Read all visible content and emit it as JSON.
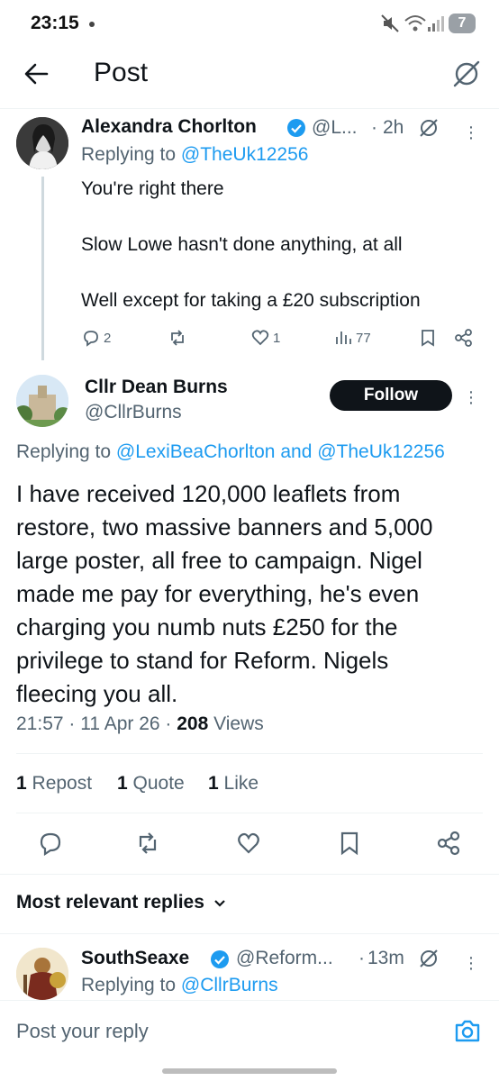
{
  "status_bar": {
    "time": "23:15",
    "battery": "7"
  },
  "header": {
    "title": "Post"
  },
  "parent_tweet": {
    "name": "Alexandra Chorlton",
    "handle": "@L...",
    "time": "2h",
    "replying_prefix": "Replying to",
    "replying_to": "@TheUk12256",
    "lines": [
      "You're right there",
      "Slow Lowe hasn't done anything, at all",
      "Well except for taking a £20 subscription"
    ],
    "actions": {
      "replies": "2",
      "likes": "1",
      "views": "77"
    }
  },
  "main_tweet": {
    "name": "Cllr Dean Burns",
    "handle": "@CllrBurns",
    "follow_label": "Follow",
    "replying_prefix": "Replying to",
    "replying_to_1": "@LexiBeaChorlton",
    "replying_and": "and",
    "replying_to_2": "@TheUk12256",
    "text_lines": [
      "I have received 120,000 leaflets from",
      "restore, two massive banners and 5,000",
      "large poster, all free to campaign. Nigel",
      "made me pay for everything, he's even",
      "charging you numb nuts £250 for the",
      "privilege to stand for Reform. Nigels",
      "fleecing you all."
    ],
    "timestamp": "21:57 · 11 Apr 26 · ",
    "views_count": "208",
    "views_label": " Views",
    "reposts_count": "1",
    "reposts_label": "Repost",
    "quotes_count": "1",
    "quotes_label": "Quote",
    "likes_count": "1",
    "likes_label": "Like"
  },
  "replies_filter": {
    "label": "Most relevant replies"
  },
  "reply_tweet": {
    "name": "SouthSeaxe",
    "handle": "@Reform...",
    "time": "13m",
    "replying_prefix": "Replying to",
    "replying_to": "@CllrBurns"
  },
  "composer": {
    "placeholder": "Post your reply"
  },
  "colors": {
    "accent": "#1d9bf0",
    "text": "#0f1419",
    "muted": "#536471",
    "button": "#0f1419"
  }
}
